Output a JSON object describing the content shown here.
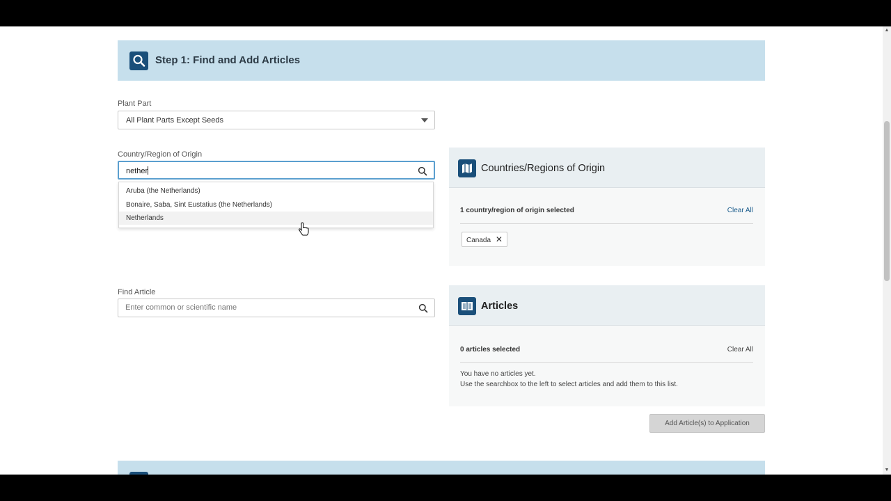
{
  "step": {
    "title": "Step 1: Find and Add Articles",
    "icon": "search-icon"
  },
  "plant_part": {
    "label": "Plant Part",
    "value": "All Plant Parts Except Seeds"
  },
  "country": {
    "label": "Country/Region of Origin",
    "value": "nether",
    "suggestions": [
      "Aruba (the Netherlands)",
      "Bonaire, Saba, Sint Eustatius (the Netherlands)",
      "Netherlands"
    ]
  },
  "find_article": {
    "label": "Find Article",
    "placeholder": "Enter common or scientific name"
  },
  "countries_panel": {
    "title": "Countries/Regions of Origin",
    "count_text": "1 country/region of origin selected",
    "clear_label": "Clear All",
    "chips": [
      "Canada"
    ],
    "icon": "map-icon"
  },
  "articles_panel": {
    "title": "Articles",
    "count_text": "0 articles selected",
    "clear_label": "Clear All",
    "empty_line1": "You have no articles yet.",
    "empty_line2": "Use the searchbox to the left to select articles and add them to this list.",
    "icon": "book-icon"
  },
  "actions": {
    "add_label": "Add Article(s) to Application"
  },
  "colors": {
    "header_bg": "#c6dfec",
    "icon_bg": "#1a4f7a",
    "link": "#1a5c8c",
    "focus_border": "#5b9fcf"
  }
}
